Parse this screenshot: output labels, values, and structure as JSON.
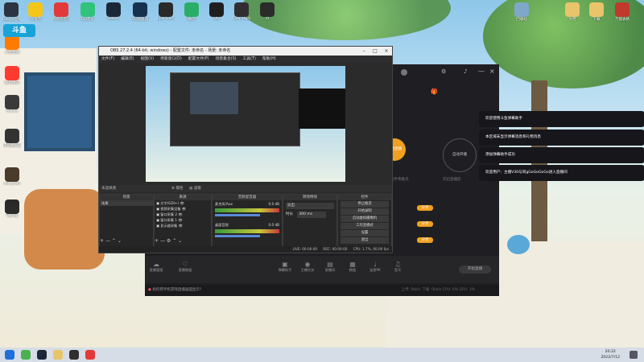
{
  "desktop": {
    "icons_top": [
      {
        "label": "Douyu直播助手",
        "icon": "tv-icon",
        "color": "#2b3440"
      },
      {
        "label": "YY语音",
        "icon": "yy-icon",
        "color": "#f5c518"
      },
      {
        "label": "网易云音乐",
        "icon": "music-icon",
        "color": "#e23a3a"
      },
      {
        "label": "QQ音乐",
        "icon": "qq-music-icon",
        "color": "#31c27c"
      },
      {
        "label": "Steam",
        "icon": "steam-icon",
        "color": "#1b2838"
      },
      {
        "label": "UU加速器",
        "icon": "uu-icon",
        "color": "#16324f"
      },
      {
        "label": "Epic Games",
        "icon": "epic-icon",
        "color": "#2a2a2a"
      },
      {
        "label": "微信",
        "icon": "wechat-icon",
        "color": "#2aae67"
      },
      {
        "label": "QQ",
        "icon": "qq-icon",
        "color": "#1f1f1f"
      },
      {
        "label": "OBS Studio",
        "icon": "obs-icon",
        "color": "#302e31"
      },
      {
        "label": "VI",
        "icon": "vi-icon",
        "color": "#2b2b2b"
      }
    ],
    "icons_right": [
      {
        "label": "回收站",
        "icon": "recycle-bin-icon",
        "color": "#7fa7c9"
      },
      {
        "label": "文档",
        "icon": "folder-icon",
        "color": "#e9c46a"
      },
      {
        "label": "下载",
        "icon": "download-folder-icon",
        "color": "#e9c46a"
      },
      {
        "label": "万能表格",
        "icon": "spreadsheet-icon",
        "color": "#c0392b"
      }
    ],
    "icons_left": [
      {
        "label": "斗鱼直播",
        "icon": "douyu-icon",
        "color": "#ff7b00"
      },
      {
        "label": "腾讯课堂",
        "icon": "class-icon",
        "color": "#ff3b2f"
      },
      {
        "label": "Nvidia",
        "icon": "nvidia-icon",
        "color": "#3a3a3a"
      },
      {
        "label": "雷电模拟器",
        "icon": "emulator-icon",
        "color": "#333"
      },
      {
        "label": "Minecraft",
        "icon": "minecraft-icon",
        "color": "#4a3b2b"
      },
      {
        "label": "TapTap",
        "icon": "taptap-icon",
        "color": "#2a2a2a"
      }
    ],
    "douyu_badge": "斗鱼"
  },
  "obs": {
    "title": "OBS 27.2.4 (64-bit, windows) - 配置文件: 未命名 - 场景: 未命名",
    "menu": [
      "文件(F)",
      "编辑(E)",
      "视图(V)",
      "停靠窗口(D)",
      "配置文件(P)",
      "场景集合(S)",
      "工具(T)",
      "帮助(H)"
    ],
    "toolbar": {
      "source_none": "未选择源",
      "props": "属性",
      "filters": "滤镜"
    },
    "docks": {
      "scenes": "场景",
      "sources": "来源",
      "mixer": "音频混音器",
      "transitions": "转场特效",
      "controls": "控件"
    },
    "scene_items": [
      "场景"
    ],
    "source_items": [
      "文字(GDI+)",
      "视频采集设备",
      "窗口采集 2",
      "窗口采集 1",
      "显示器采集"
    ],
    "mixer": [
      {
        "name": "麦克风/Aux",
        "db": "0.0 dB"
      },
      {
        "name": "桌面音频",
        "db": "0.0 dB"
      }
    ],
    "transition": {
      "type": "淡出",
      "duration_label": "时长",
      "duration": "300 ms"
    },
    "controls": [
      "停止推流",
      "开始录制",
      "启动虚拟摄像机",
      "工作室模式",
      "设置",
      "退出"
    ],
    "status": {
      "live": "LIVE: 00:00:00",
      "rec": "REC: 00:00:00",
      "cpu": "CPU: 1.7%, 60.00 fps"
    }
  },
  "douyu_helper": {
    "buttons": [
      "Windows",
      "游戏",
      "手机",
      "设置"
    ],
    "modes": [
      {
        "label": "开始直播",
        "active": true
      },
      {
        "label": "自动开播",
        "active": false
      }
    ],
    "mode_desc": [
      "手游助手将推流",
      "开启直播后"
    ],
    "share_labels": [
      "分享",
      "分享",
      "分享"
    ],
    "bottom_icons": [
      "弹幕助手",
      "主播任务",
      "直播间",
      "数据",
      "连麦PK",
      "音乐",
      "美颜",
      "录屏"
    ],
    "start_button": "开始直播",
    "footer": "如何把手机游戏直播画面显示?",
    "stats": "上传: 0kb/s  下载: 0kb/s  CPU: 6%  GPU: 3%",
    "side_tabs": [
      "直播管理",
      "直播数据"
    ]
  },
  "notifications": [
    {
      "text": "欢迎使用斗鱼弹幕助手"
    },
    {
      "text": "本区域未显示弹幕消息和礼物消息"
    },
    {
      "text": "添加弹幕助手成功"
    },
    {
      "text": "欢迎用户：主播V30与同gGoGoGoGo进入直播间"
    }
  ],
  "taskbar": {
    "time": "20:22",
    "date": "2022/7/12",
    "apps": [
      {
        "icon": "windows-start-icon",
        "color": "#1e6fd9"
      },
      {
        "icon": "chrome-icon",
        "color": "#4caf50"
      },
      {
        "icon": "steam-icon",
        "color": "#1b2838"
      },
      {
        "icon": "explorer-icon",
        "color": "#e9c46a"
      },
      {
        "icon": "obs-icon",
        "color": "#302e31"
      },
      {
        "icon": "music-icon",
        "color": "#e23a3a"
      }
    ]
  }
}
